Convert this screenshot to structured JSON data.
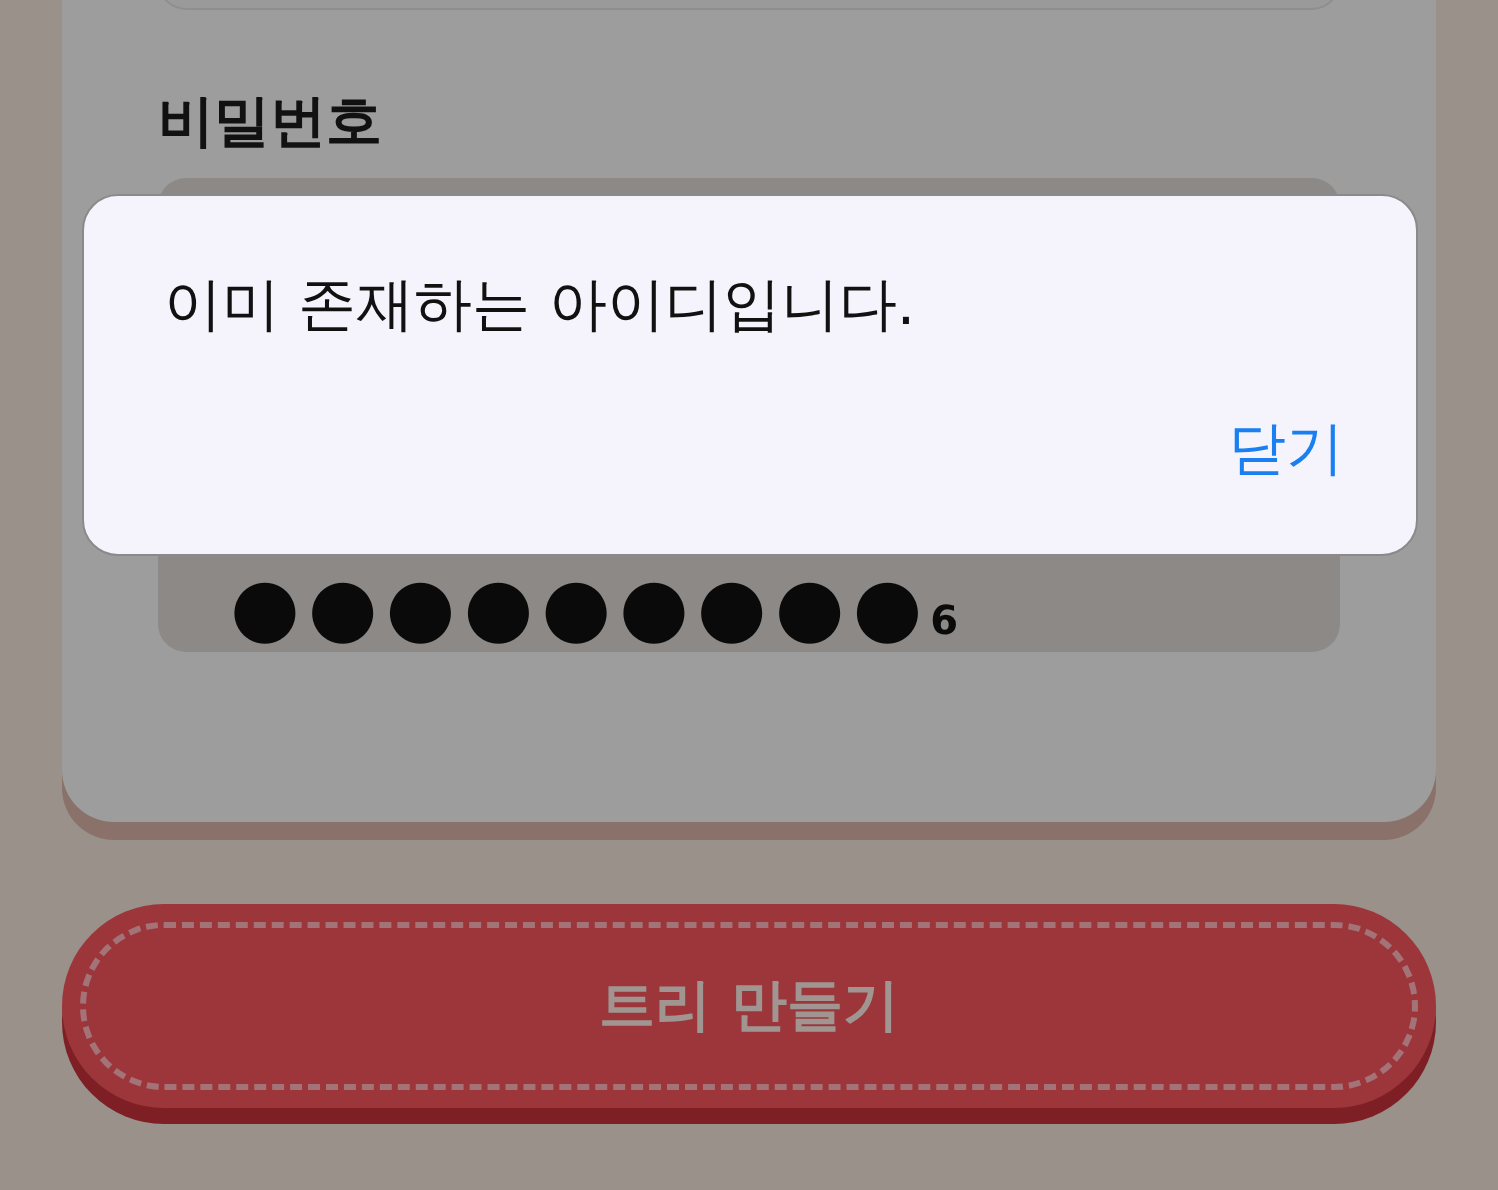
{
  "form": {
    "password_label": "비밀번호",
    "password_field": {
      "masked": "●●●●●●●●●",
      "last": "6"
    }
  },
  "submit_button": {
    "label": "트리 만들기"
  },
  "alert": {
    "message": "이미 존재하는 아이디입니다.",
    "button": "닫기"
  }
}
